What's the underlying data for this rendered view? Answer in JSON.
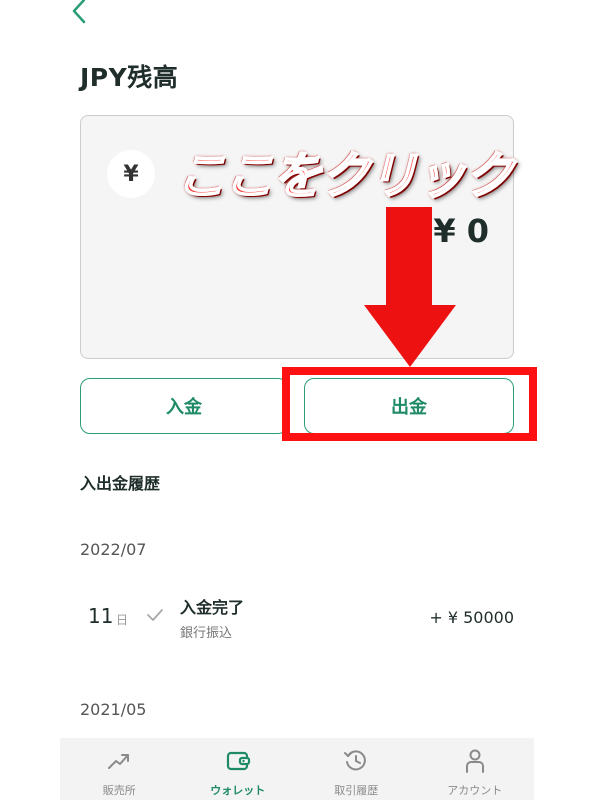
{
  "header": {
    "title": "JPY残高"
  },
  "balance": {
    "currency_symbol": "¥",
    "amount": "¥ 0"
  },
  "annotation": {
    "text": "ここをクリック"
  },
  "actions": {
    "deposit_label": "入金",
    "withdraw_label": "出金"
  },
  "history": {
    "title": "入出金履歴",
    "months": [
      "2022/07",
      "2021/05"
    ],
    "transactions": [
      {
        "day": "11",
        "day_unit": "日",
        "title": "入金完了",
        "method": "銀行振込",
        "amount": "+ ¥ 50000"
      }
    ]
  },
  "nav": {
    "items": [
      {
        "label": "販売所",
        "icon": "trend-icon",
        "active": false
      },
      {
        "label": "ウォレット",
        "icon": "wallet-icon",
        "active": true
      },
      {
        "label": "取引履歴",
        "icon": "history-icon",
        "active": false
      },
      {
        "label": "アカウント",
        "icon": "person-icon",
        "active": false
      }
    ]
  },
  "colors": {
    "accent": "#2a9d75",
    "highlight": "#ff1111"
  }
}
